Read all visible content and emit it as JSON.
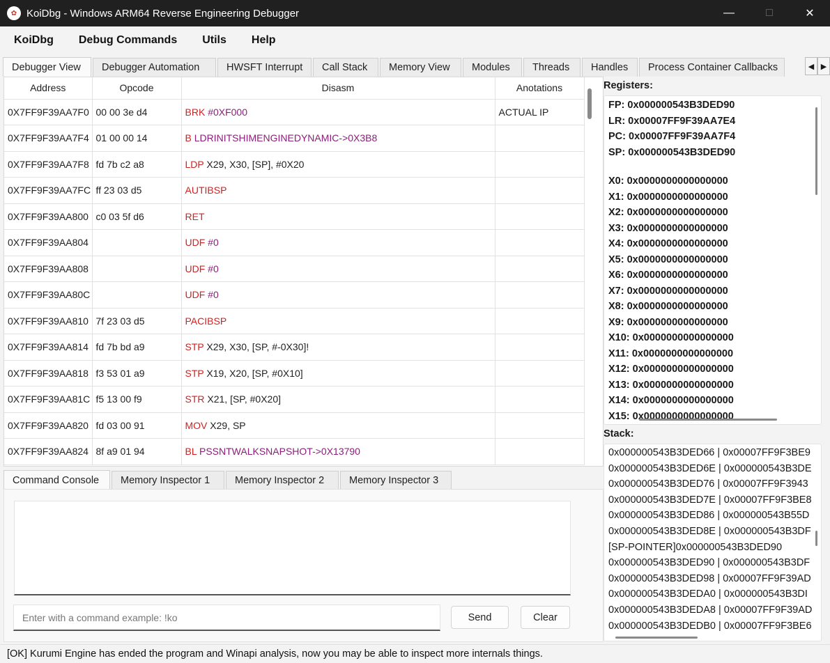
{
  "window": {
    "title": "KoiDbg - Windows ARM64 Reverse Engineering Debugger",
    "icon": "koi-logo-icon"
  },
  "menu": [
    {
      "label": "KoiDbg"
    },
    {
      "label": "Debug Commands"
    },
    {
      "label": "Utils"
    },
    {
      "label": "Help"
    }
  ],
  "tabs": [
    {
      "label": "Debugger View",
      "active": true
    },
    {
      "label": "Debugger Automation"
    },
    {
      "label": "HWSFT Interrupt"
    },
    {
      "label": "Call Stack"
    },
    {
      "label": "Memory View"
    },
    {
      "label": "Modules"
    },
    {
      "label": "Threads"
    },
    {
      "label": "Handles"
    },
    {
      "label": "Process Container Callbacks"
    }
  ],
  "disasm": {
    "headers": {
      "address": "Address",
      "opcode": "Opcode",
      "disasm": "Disasm",
      "annotations": "Anotations"
    },
    "rows": [
      {
        "address": "0X7FF9F39AA7F0",
        "opcode": "00 00 3e d4",
        "mnemonic": "BRK",
        "operands": "#0XF000",
        "operand_style": "imm",
        "annotation": "ACTUAL IP"
      },
      {
        "address": "0X7FF9F39AA7F4",
        "opcode": "01 00 00 14",
        "mnemonic": "B",
        "operands": "LDRINITSHIMENGINEDYNAMIC->0X3B8",
        "operand_style": "branch",
        "annotation": ""
      },
      {
        "address": "0X7FF9F39AA7F8",
        "opcode": "fd 7b c2 a8",
        "mnemonic": "LDP",
        "operands": "X29, X30, [SP], #0X20",
        "operand_style": "plain",
        "annotation": ""
      },
      {
        "address": "0X7FF9F39AA7FC",
        "opcode": "ff 23 03 d5",
        "mnemonic": "AUTIBSP",
        "operands": "",
        "operand_style": "plain",
        "annotation": ""
      },
      {
        "address": "0X7FF9F39AA800",
        "opcode": "c0 03 5f d6",
        "mnemonic": "RET",
        "operands": "",
        "operand_style": "plain",
        "annotation": ""
      },
      {
        "address": "0X7FF9F39AA804",
        "opcode": "",
        "mnemonic": "UDF",
        "operands": "#0",
        "operand_style": "imm",
        "annotation": ""
      },
      {
        "address": "0X7FF9F39AA808",
        "opcode": "",
        "mnemonic": "UDF",
        "operands": "#0",
        "operand_style": "imm",
        "annotation": ""
      },
      {
        "address": "0X7FF9F39AA80C",
        "opcode": "",
        "mnemonic": "UDF",
        "operands": "#0",
        "operand_style": "imm",
        "annotation": ""
      },
      {
        "address": "0X7FF9F39AA810",
        "opcode": "7f 23 03 d5",
        "mnemonic": "PACIBSP",
        "operands": "",
        "operand_style": "plain",
        "annotation": ""
      },
      {
        "address": "0X7FF9F39AA814",
        "opcode": "fd 7b bd a9",
        "mnemonic": "STP",
        "operands": "X29, X30, [SP, #-0X30]!",
        "operand_style": "plain",
        "annotation": ""
      },
      {
        "address": "0X7FF9F39AA818",
        "opcode": "f3 53 01 a9",
        "mnemonic": "STP",
        "operands": "X19, X20, [SP, #0X10]",
        "operand_style": "plain",
        "annotation": ""
      },
      {
        "address": "0X7FF9F39AA81C",
        "opcode": "f5 13 00 f9",
        "mnemonic": "STR",
        "operands": "X21, [SP, #0X20]",
        "operand_style": "plain",
        "annotation": ""
      },
      {
        "address": "0X7FF9F39AA820",
        "opcode": "fd 03 00 91",
        "mnemonic": "MOV",
        "operands": "X29, SP",
        "operand_style": "plain",
        "annotation": ""
      },
      {
        "address": "0X7FF9F39AA824",
        "opcode": "8f a9 01 94",
        "mnemonic": "BL",
        "operands": "PSSNTWALKSNAPSHOT->0X13790",
        "operand_style": "branch",
        "annotation": ""
      }
    ]
  },
  "bottom_tabs": [
    {
      "label": "Command Console",
      "active": true
    },
    {
      "label": "Memory Inspector 1"
    },
    {
      "label": "Memory Inspector 2"
    },
    {
      "label": "Memory Inspector 3"
    }
  ],
  "console": {
    "output": "",
    "input_value": "",
    "input_placeholder": "Enter with a command example: !ko",
    "send_label": "Send",
    "clear_label": "Clear"
  },
  "registers": {
    "label": "Registers:",
    "special": [
      "FP: 0x000000543B3DED90",
      "LR: 0x00007FF9F39AA7E4",
      "PC: 0x00007FF9F39AA7F4",
      "SP: 0x000000543B3DED90"
    ],
    "general": [
      "X0: 0x0000000000000000",
      "X1: 0x0000000000000000",
      "X2: 0x0000000000000000",
      "X3: 0x0000000000000000",
      "X4: 0x0000000000000000",
      "X5: 0x0000000000000000",
      "X6: 0x0000000000000000",
      "X7: 0x0000000000000000",
      "X8: 0x0000000000000000",
      "X9: 0x0000000000000000",
      "X10: 0x0000000000000000",
      "X11: 0x0000000000000000",
      "X12: 0x0000000000000000",
      "X13: 0x0000000000000000",
      "X14: 0x0000000000000000",
      "X15: 0x0000000000000000"
    ]
  },
  "stack": {
    "label": "Stack:",
    "entries": [
      "0x000000543B3DED66 | 0x00007FF9F3BE9",
      "0x000000543B3DED6E | 0x000000543B3DE",
      "0x000000543B3DED76 | 0x00007FF9F3943",
      "0x000000543B3DED7E | 0x00007FF9F3BE8",
      "0x000000543B3DED86 | 0x000000543B55D",
      "0x000000543B3DED8E | 0x000000543B3DF",
      "[SP-POINTER]0x000000543B3DED90",
      "0x000000543B3DED90 | 0x000000543B3DF",
      "0x000000543B3DED98 | 0x00007FF9F39AD",
      "0x000000543B3DEDA0 | 0x000000543B3DI",
      "0x000000543B3DEDA8 | 0x00007FF9F39AD",
      "0x000000543B3DEDB0 | 0x00007FF9F3BE6"
    ]
  },
  "status": "[OK] Kurumi Engine has ended the program and Winapi analysis, now you may be able to inspect more internals things.",
  "colors": {
    "mnemonic": "#d42020",
    "symbol": "#8a1f7a",
    "titlebar": "#202020"
  }
}
